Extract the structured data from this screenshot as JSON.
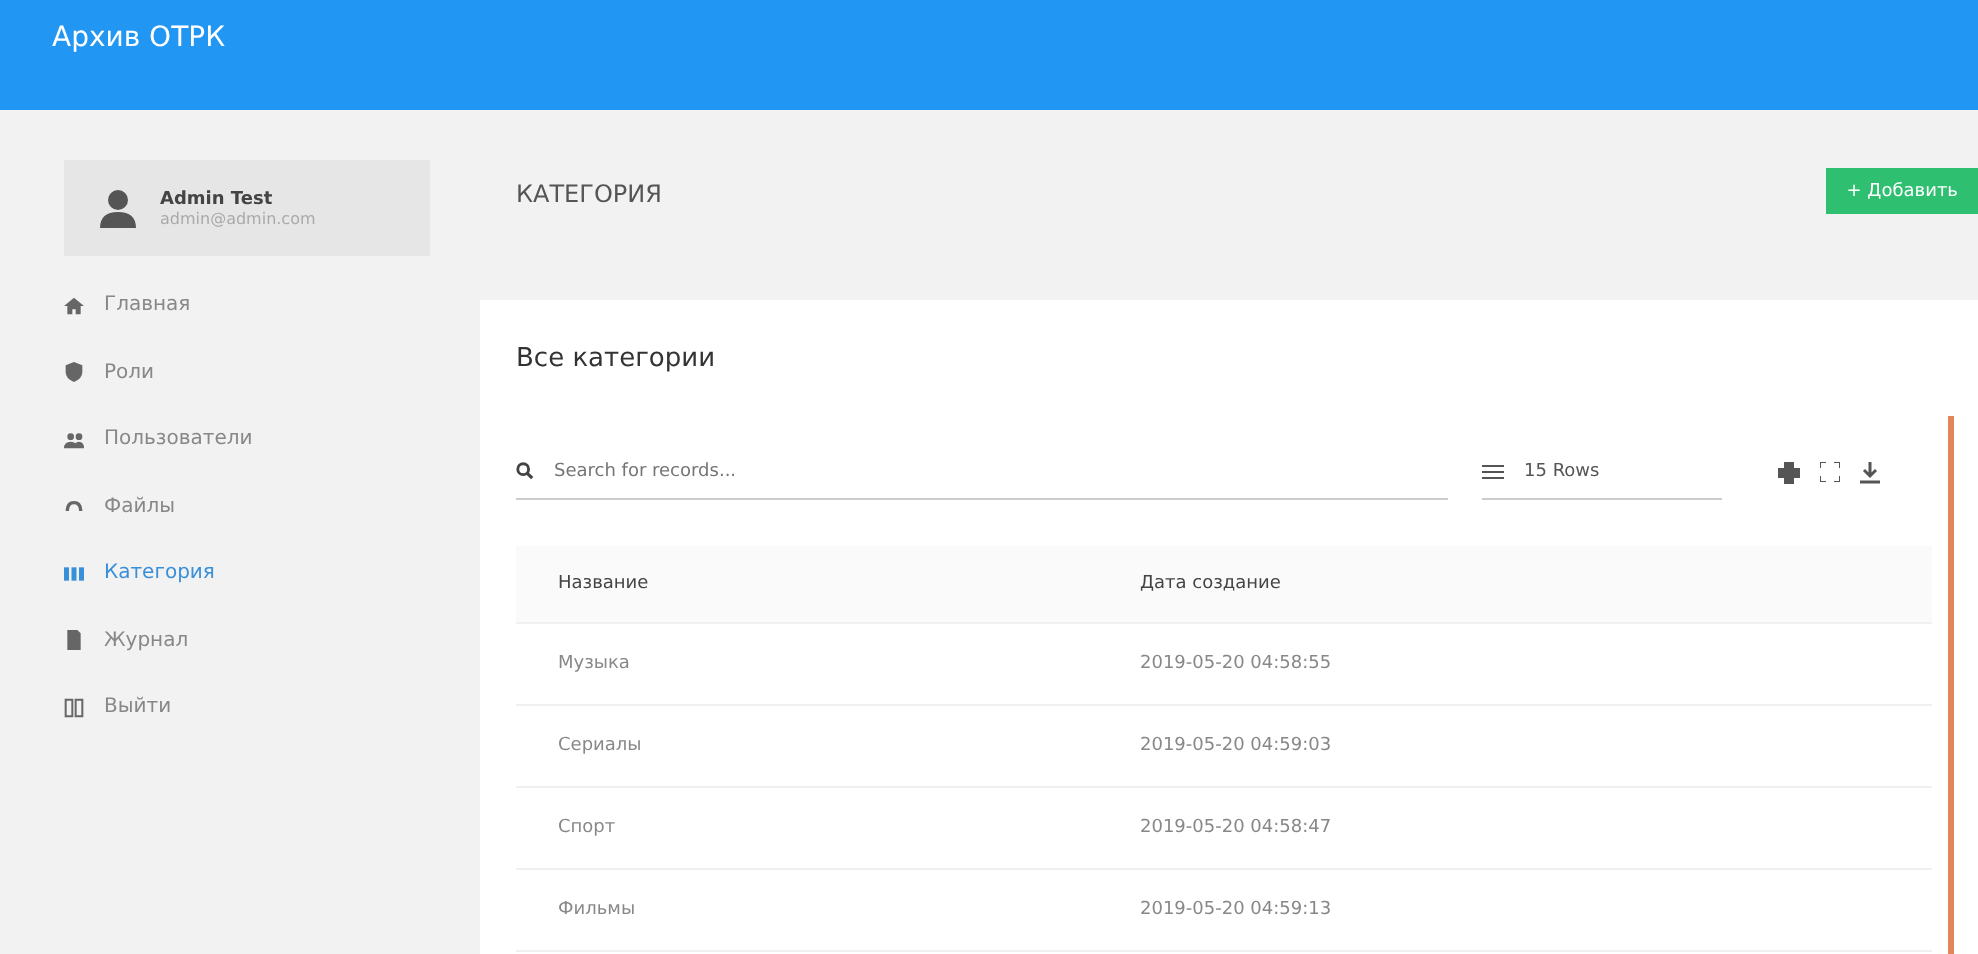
{
  "app_title": "Архив ОТРК",
  "user": {
    "name": "Admin Test",
    "email": "admin@admin.com"
  },
  "sidebar": {
    "items": [
      {
        "label": "Главная",
        "selected": false
      },
      {
        "label": "Роли",
        "selected": false
      },
      {
        "label": "Пользователи",
        "selected": false
      },
      {
        "label": "Файлы",
        "selected": false
      },
      {
        "label": "Категория",
        "selected": true
      },
      {
        "label": "Журнал",
        "selected": false
      },
      {
        "label": "Выйти",
        "selected": false
      }
    ]
  },
  "page_title": "КАТЕГОРИЯ",
  "add_button": "+ Добавить",
  "panel_title": "Все категории",
  "search": {
    "placeholder": "Search for records..."
  },
  "rows_select": "15 Rows",
  "table": {
    "columns": [
      "Название",
      "Дата создание"
    ],
    "rows": [
      [
        "Музыка",
        "2019-05-20 04:58:55"
      ],
      [
        "Сериалы",
        "2019-05-20 04:59:03"
      ],
      [
        "Спорт",
        "2019-05-20 04:58:47"
      ],
      [
        "Фильмы",
        "2019-05-20 04:59:13"
      ]
    ]
  }
}
